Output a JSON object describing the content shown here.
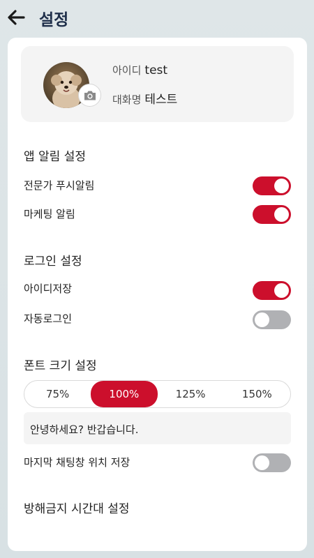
{
  "header": {
    "back_icon": "arrow-left-icon",
    "title": "설정"
  },
  "profile": {
    "id_label": "아이디",
    "id_value": "test",
    "nickname_label": "대화명",
    "nickname_value": "테스트",
    "camera_icon": "camera-icon"
  },
  "notifications": {
    "title": "앱 알림 설정",
    "items": [
      {
        "label": "전문가 푸시알림",
        "on": true
      },
      {
        "label": "마케팅 알림",
        "on": true
      }
    ]
  },
  "login": {
    "title": "로그인 설정",
    "items": [
      {
        "label": "아이디저장",
        "on": true
      },
      {
        "label": "자동로그인",
        "on": false
      }
    ]
  },
  "font_size": {
    "title": "폰트 크기 설정",
    "options": [
      "75%",
      "100%",
      "125%",
      "150%"
    ],
    "selected": "100%",
    "preview_text": "안녕하세요? 반갑습니다."
  },
  "chat_position": {
    "label": "마지막 채팅창 위치 저장",
    "on": false
  },
  "dnd": {
    "title": "방해금지 시간대 설정"
  },
  "colors": {
    "accent": "#cc0f2c",
    "toggle_off": "#b0b1b4",
    "title": "#1f2f4a"
  }
}
